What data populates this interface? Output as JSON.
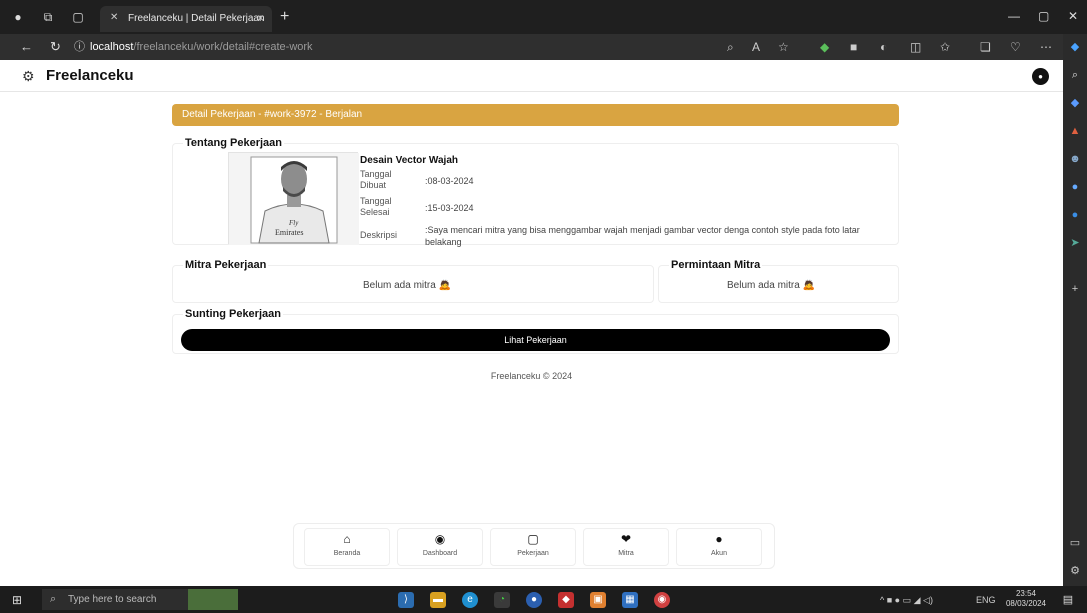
{
  "browser": {
    "tab_title": "Freelanceku | Detail Pekerjaan",
    "url_host": "localhost",
    "url_path": "/freelanceku/work/detail#create-work"
  },
  "app": {
    "brand": "Freelanceku"
  },
  "detail": {
    "banner": "Detail Pekerjaan - #work-3972 - Berjalan",
    "about_title": "Tentang Pekerjaan",
    "job_title": "Desain Vector Wajah",
    "created_label": "Tanggal Dibuat",
    "created_value": ":08-03-2024",
    "finished_label": "Tanggal Selesai",
    "finished_value": ":15-03-2024",
    "description_label": "Deskripsi",
    "description_value": ":Saya mencari mitra yang bisa menggambar wajah menjadi gambar vector denga contoh style pada foto latar belakang",
    "shirt_text_1": "Fly",
    "shirt_text_2": "Emirates"
  },
  "partner": {
    "title": "Mitra Pekerjaan",
    "empty": "Belum ada mitra 🙇"
  },
  "requests": {
    "title": "Permintaan Mitra",
    "empty": "Belum ada mitra 🙇"
  },
  "edit": {
    "title": "Sunting Pekerjaan",
    "button": "Lihat Pekerjaan"
  },
  "footer": "Freelanceku © 2024",
  "bottom_nav": [
    {
      "label": "Beranda",
      "icon": "home-icon"
    },
    {
      "label": "Dashboard",
      "icon": "dashboard-icon"
    },
    {
      "label": "Pekerjaan",
      "icon": "work-icon"
    },
    {
      "label": "Mitra",
      "icon": "handshake-icon"
    },
    {
      "label": "Akun",
      "icon": "account-icon"
    }
  ],
  "taskbar": {
    "search_placeholder": "Type here to search",
    "lang": "ENG",
    "time": "23:54",
    "date": "08/03/2024"
  },
  "colors": {
    "banner": "#d9a441",
    "button": "#000000"
  }
}
